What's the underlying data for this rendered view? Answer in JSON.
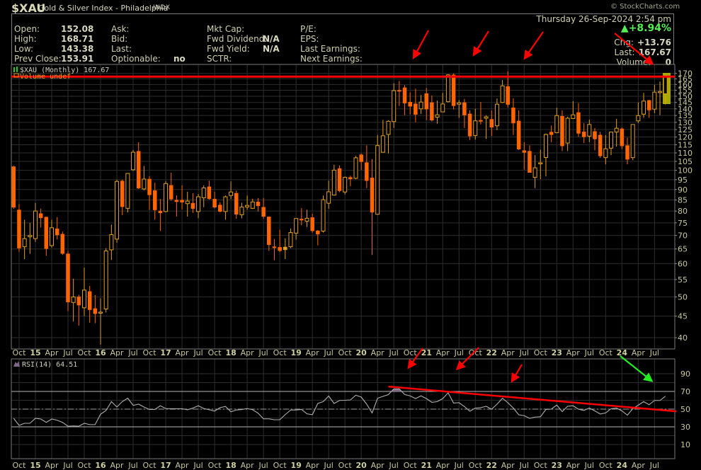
{
  "header": {
    "symbol": "$XAU",
    "name": "Gold & Silver Index - Philadelphia",
    "exchange": "INDX",
    "copyright": "© StockCharts.com",
    "datetime": "Thursday  26-Sep-2024  2:54 pm",
    "change_pct": "+8.94%",
    "change_icon": "triangle-up-icon",
    "change_color": "#55ee55",
    "chg_label": "Chg:",
    "chg_value": "+13.76",
    "last_label": "Last:",
    "last_value": "167.67",
    "volume_label": "Volume:",
    "volume_value": "0"
  },
  "quote": {
    "col1": [
      {
        "label": "Open:",
        "value": "152.08"
      },
      {
        "label": "High:",
        "value": "168.71"
      },
      {
        "label": "Low:",
        "value": "143.38"
      },
      {
        "label": "Prev Close:",
        "value": "153.91"
      }
    ],
    "col2": [
      {
        "label": "Ask:",
        "value": ""
      },
      {
        "label": "Bid:",
        "value": ""
      },
      {
        "label": "Last:",
        "value": ""
      },
      {
        "label": "Optionable:",
        "value": "no"
      }
    ],
    "col3": [
      {
        "label": "Mkt Cap:",
        "value": ""
      },
      {
        "label": "Fwd Dividend:",
        "value": "N/A"
      },
      {
        "label": "Fwd Yield:",
        "value": "N/A"
      },
      {
        "label": "SCTR:",
        "value": ""
      }
    ],
    "col4": [
      {
        "label": "P/E:",
        "value": ""
      },
      {
        "label": "EPS:",
        "value": ""
      },
      {
        "label": "Last Earnings:",
        "value": ""
      },
      {
        "label": "Next Earnings:",
        "value": ""
      }
    ]
  },
  "chart_data": [
    {
      "type": "candlestick",
      "legend": "$XAU (Monthly) 167.67",
      "legend2": "Volume undef",
      "period": {
        "start": "Sep 2014",
        "end": "Sep 2024",
        "interval": "monthly"
      },
      "y_scale": "log",
      "ylim": [
        37.5,
        178
      ],
      "y_ticks": [
        40,
        45,
        50,
        55,
        60,
        65,
        70,
        75,
        80,
        85,
        90,
        95,
        100,
        105,
        110,
        115,
        120,
        125,
        130,
        135,
        140,
        145,
        150,
        155,
        160,
        165,
        170
      ],
      "x_tick_labels": [
        "Oct",
        "15",
        "Apr",
        "Jul",
        "Oct",
        "16",
        "Apr",
        "Jul",
        "Oct",
        "17",
        "Apr",
        "Jul",
        "Oct",
        "18",
        "Apr",
        "Jul",
        "Oct",
        "19",
        "Apr",
        "Jul",
        "Oct",
        "20",
        "Apr",
        "Jul",
        "Oct",
        "21",
        "Apr",
        "Jul",
        "Oct",
        "22",
        "Apr",
        "Jul",
        "Oct",
        "23",
        "Apr",
        "Jul",
        "Oct",
        "24",
        "Apr",
        "Jul"
      ],
      "grid": true,
      "colors": {
        "down": "#ff6600",
        "up": "#e0a020",
        "annotation": "#ff0000",
        "highlight": "#a8a800"
      },
      "ohlc_fields": [
        "open",
        "high",
        "low",
        "close"
      ],
      "ohlc": [
        [
          102,
          102.5,
          81,
          81.7
        ],
        [
          80.5,
          83,
          64,
          65.3
        ],
        [
          65.8,
          76.3,
          61.5,
          68.8
        ],
        [
          69.5,
          75,
          63.3,
          70
        ],
        [
          68.8,
          83.6,
          67.6,
          80
        ],
        [
          78.9,
          81.1,
          73.1,
          77.1
        ],
        [
          77.4,
          77.6,
          62.6,
          65.1
        ],
        [
          66.2,
          76.3,
          65.5,
          73
        ],
        [
          72.6,
          77.4,
          68.5,
          70.2
        ],
        [
          70.5,
          71.5,
          62.9,
          63.4
        ],
        [
          63.3,
          64.3,
          46.3,
          48.6
        ],
        [
          48.5,
          55.2,
          43.7,
          50
        ],
        [
          50,
          50.6,
          42.7,
          47.8
        ],
        [
          47.1,
          58.7,
          45,
          51.9
        ],
        [
          51.5,
          53.1,
          43.4,
          46.6
        ],
        [
          46.9,
          50.5,
          43.3,
          45.6
        ],
        [
          45.8,
          49.6,
          38.5,
          46
        ],
        [
          46.8,
          65.3,
          45.9,
          64.3
        ],
        [
          64.7,
          74.3,
          61.2,
          70.3
        ],
        [
          68.6,
          95,
          67.3,
          94.1
        ],
        [
          94.3,
          95,
          78.2,
          81.9
        ],
        [
          81.2,
          98.5,
          79.4,
          98.3
        ],
        [
          100.3,
          111.8,
          99.7,
          110.4
        ],
        [
          111,
          116.6,
          90.3,
          90.7
        ],
        [
          90.3,
          102.4,
          89.6,
          95.3
        ],
        [
          95.3,
          96.8,
          80.5,
          87.4
        ],
        [
          89.5,
          93.4,
          76.3,
          80.5
        ],
        [
          80,
          85.4,
          71.8,
          79.2
        ],
        [
          79.8,
          94.3,
          79.5,
          93
        ],
        [
          92.1,
          98.7,
          84.6,
          85.4
        ],
        [
          84.9,
          87.2,
          77.6,
          84.2
        ],
        [
          84.9,
          92.1,
          80.7,
          84
        ],
        [
          83.3,
          88.9,
          77.6,
          84.5
        ],
        [
          83.5,
          88.2,
          79.2,
          81.1
        ],
        [
          79.8,
          87.8,
          76.9,
          86.5
        ],
        [
          86,
          92.1,
          81.7,
          90.8
        ],
        [
          91.4,
          94.5,
          85.1,
          85.6
        ],
        [
          85.4,
          88.9,
          81.2,
          81.7
        ],
        [
          82.7,
          84,
          79.4,
          79.8
        ],
        [
          79.8,
          87.1,
          76.3,
          86.5
        ],
        [
          87.1,
          94.1,
          85.4,
          88.8
        ],
        [
          88.2,
          89.5,
          76.7,
          78.6
        ],
        [
          78.4,
          83.7,
          76.9,
          81.8
        ],
        [
          81.8,
          87.1,
          80.5,
          82.5
        ],
        [
          81.2,
          85.6,
          80.9,
          84.1
        ],
        [
          84.1,
          85.9,
          79.8,
          82.3
        ],
        [
          81.7,
          85.9,
          76.7,
          77.7
        ],
        [
          77.5,
          77.6,
          64.3,
          66.5
        ],
        [
          65.8,
          68.6,
          61.1,
          65.5
        ],
        [
          65.6,
          72.2,
          63.9,
          64.4
        ],
        [
          65.7,
          68.9,
          61.5,
          64.7
        ],
        [
          65.8,
          72.7,
          65.3,
          71.1
        ],
        [
          70.9,
          76.9,
          68.4,
          76.8
        ],
        [
          76.6,
          81.3,
          74,
          76.1
        ],
        [
          75.7,
          80.6,
          73.3,
          76.9
        ],
        [
          77.2,
          78.8,
          71.1,
          71.8
        ],
        [
          71.8,
          72.1,
          66.3,
          70.5
        ],
        [
          71.7,
          87.1,
          71.1,
          85.1
        ],
        [
          83.5,
          94.5,
          81,
          88.9
        ],
        [
          87.3,
          103.1,
          87.1,
          100.1
        ],
        [
          101,
          102.7,
          88.7,
          89.4
        ],
        [
          88.8,
          96.6,
          87.6,
          96.2
        ],
        [
          96.2,
          97.1,
          91.6,
          95.4
        ],
        [
          95.7,
          108.2,
          95.3,
          107.1
        ],
        [
          108.9,
          109.7,
          100.3,
          104.8
        ],
        [
          104.3,
          114.6,
          90.7,
          94.5
        ],
        [
          95.9,
          106.4,
          62.9,
          79.5
        ],
        [
          78.6,
          121.3,
          78.4,
          114.5
        ],
        [
          110.4,
          131.7,
          110.2,
          120.8
        ],
        [
          121.7,
          131.5,
          109.7,
          130.8
        ],
        [
          130.6,
          161,
          126.1,
          154.7
        ],
        [
          155,
          163,
          142.2,
          154.4
        ],
        [
          157.2,
          159.4,
          135.3,
          144.4
        ],
        [
          145.3,
          153.2,
          135.8,
          142
        ],
        [
          143.9,
          156.4,
          130.1,
          135.8
        ],
        [
          140,
          151,
          136.2,
          145.3
        ],
        [
          152.2,
          157,
          131.6,
          139.8
        ],
        [
          144.9,
          150.6,
          130.6,
          131.6
        ],
        [
          133.8,
          146.5,
          129.1,
          135.5
        ],
        [
          137.7,
          152.8,
          137.5,
          143.8
        ],
        [
          145.6,
          169.3,
          145,
          168.6
        ],
        [
          168.6,
          170,
          139.6,
          142.4
        ],
        [
          143.6,
          146.8,
          133.3,
          144.7
        ],
        [
          144.9,
          147.8,
          126.1,
          135.3
        ],
        [
          136.2,
          138.9,
          118.1,
          120.6
        ],
        [
          121,
          140,
          118.3,
          131.1
        ],
        [
          131.5,
          145.4,
          128.6,
          130.8
        ],
        [
          133,
          135.2,
          118.7,
          134
        ],
        [
          132.2,
          138.9,
          120.6,
          126.6
        ],
        [
          127.6,
          148.2,
          124.6,
          143.6
        ],
        [
          145,
          164,
          144.5,
          158.8
        ],
        [
          158.3,
          172,
          141,
          143.4
        ],
        [
          140.8,
          148.4,
          121.4,
          129.5
        ],
        [
          131,
          138.9,
          111.8,
          112.3
        ],
        [
          111.4,
          116.6,
          100.4,
          110.3
        ],
        [
          111,
          114.6,
          98.8,
          98.8
        ],
        [
          96.2,
          108.7,
          90.7,
          101.4
        ],
        [
          104,
          112,
          95.3,
          104.2
        ],
        [
          107.3,
          122.3,
          96.8,
          121.7
        ],
        [
          123.3,
          127.8,
          116.7,
          121.5
        ],
        [
          122.9,
          140.8,
          122.6,
          134.9
        ],
        [
          134.5,
          138.9,
          111.1,
          114.3
        ],
        [
          116.1,
          134,
          111.1,
          133
        ],
        [
          132.8,
          146,
          132.5,
          135.5
        ],
        [
          137.2,
          144.5,
          120.1,
          122.4
        ],
        [
          123.4,
          129.4,
          116.1,
          120.1
        ],
        [
          120.6,
          132,
          116.7,
          128.5
        ],
        [
          123.7,
          126,
          111.5,
          118.7
        ],
        [
          121.3,
          123.5,
          107,
          108.2
        ],
        [
          107.2,
          121.3,
          103.3,
          112.5
        ],
        [
          112.9,
          123.5,
          108.7,
          123.3
        ],
        [
          123.3,
          132.6,
          113.9,
          125.9
        ],
        [
          125.5,
          126.4,
          112.3,
          114.3
        ],
        [
          114.5,
          119.6,
          103.3,
          106.2
        ],
        [
          107.2,
          128.7,
          105.7,
          128.5
        ],
        [
          131.1,
          144.9,
          129.5,
          134.9
        ],
        [
          136,
          152.8,
          133.3,
          146.1
        ],
        [
          146.7,
          147,
          133.3,
          139.1
        ],
        [
          139.8,
          159.7,
          136.8,
          153.4
        ],
        [
          153.4,
          162.6,
          135.3,
          153.91
        ],
        [
          152.08,
          168.71,
          143.38,
          167.67
        ]
      ],
      "annotations": {
        "resistance_line": 167,
        "arrows": "red arrows pointing to tops"
      }
    },
    {
      "type": "line",
      "legend": "RSI(14) 64.51",
      "ylim": [
        0,
        100
      ],
      "y_ticks": [
        10,
        30,
        50,
        70,
        90
      ],
      "reference_lines": {
        "overbought": 70,
        "midline": 50,
        "oversold": 30
      },
      "x_tick_labels": [
        "Oct",
        "15",
        "Apr",
        "Jul",
        "Oct",
        "16",
        "Apr",
        "Jul",
        "Oct",
        "17",
        "Apr",
        "Jul",
        "Oct",
        "18",
        "Apr",
        "Jul",
        "Oct",
        "19",
        "Apr",
        "Jul",
        "Oct",
        "20",
        "Apr",
        "Jul",
        "Oct",
        "21",
        "Apr",
        "Jul",
        "Oct",
        "22",
        "Apr",
        "Jul",
        "Oct",
        "23",
        "Apr",
        "Jul",
        "Oct",
        "24",
        "Apr",
        "Jul"
      ],
      "colors": {
        "line": "#b0b0b0",
        "overbought_fill": "#806888",
        "trendline": "#ff0000",
        "arrow_bullish": "#22ee22"
      },
      "values": [
        39.6,
        31.6,
        34,
        34,
        39.6,
        38.8,
        35,
        38.8,
        37.5,
        35,
        30.7,
        31,
        30.7,
        34,
        32.5,
        32.5,
        44.3,
        48.4,
        58.5,
        52.4,
        58.5,
        62.4,
        54.3,
        55.6,
        52.4,
        49.6,
        49.6,
        53.8,
        50.7,
        50.5,
        50.5,
        50.5,
        49.3,
        51.2,
        53.8,
        50.7,
        49.3,
        47.8,
        51.7,
        53,
        47,
        49,
        49.5,
        50.7,
        49.3,
        45.5,
        39,
        39,
        38,
        38,
        43.8,
        49,
        49,
        49.6,
        44.7,
        43.7,
        56.4,
        58.5,
        64.8,
        56.4,
        59.8,
        60,
        60.4,
        65.7,
        63.6,
        55.6,
        45.7,
        62.3,
        64.4,
        66.5,
        72.9,
        72.9,
        66.5,
        65,
        61.9,
        65,
        61.9,
        57.7,
        58.5,
        61.9,
        68.4,
        56.9,
        57.3,
        52.9,
        47.6,
        51.2,
        51.7,
        53.2,
        49.9,
        55.6,
        62.3,
        57.2,
        51.2,
        43.6,
        42.6,
        39.6,
        41,
        41.4,
        49.6,
        50,
        54.6,
        47.2,
        53.2,
        53.8,
        49.9,
        48.6,
        51.2,
        48,
        44.5,
        45.7,
        50.5,
        51.2,
        48,
        43.2,
        50.5,
        54.5,
        58.5,
        55,
        59.8,
        59.8,
        64.51
      ],
      "trendline": {
        "from": {
          "month_index": 69,
          "value": 75.5
        },
        "to": {
          "month_index": 122,
          "value": 47.5
        }
      }
    }
  ]
}
